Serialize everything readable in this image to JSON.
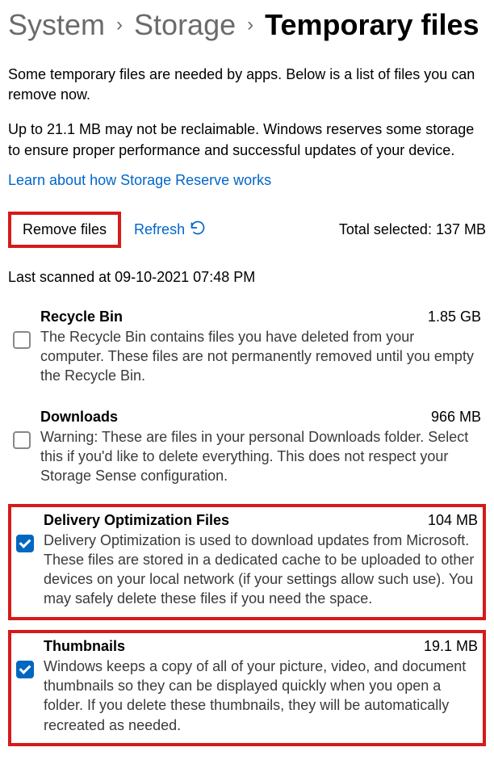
{
  "breadcrumb": {
    "system": "System",
    "storage": "Storage",
    "current": "Temporary files"
  },
  "intro1": "Some temporary files are needed by apps. Below is a list of files you can remove now.",
  "intro2": "Up to 21.1 MB may not be reclaimable. Windows reserves some storage to ensure proper performance and successful updates of your device.",
  "learn_link": "Learn about how Storage Reserve works",
  "actions": {
    "remove": "Remove files",
    "refresh": "Refresh",
    "total_label": "Total selected: ",
    "total_value": "137 MB"
  },
  "scanned": "Last scanned at 09-10-2021 07:48 PM",
  "items": [
    {
      "title": "Recycle Bin",
      "size": "1.85 GB",
      "desc": "The Recycle Bin contains files you have deleted from your computer. These files are not permanently removed until you empty the Recycle Bin.",
      "checked": false,
      "highlight": false
    },
    {
      "title": "Downloads",
      "size": "966 MB",
      "desc": "Warning: These are files in your personal Downloads folder. Select this if you'd like to delete everything. This does not respect your Storage Sense configuration.",
      "checked": false,
      "highlight": false
    },
    {
      "title": "Delivery Optimization Files",
      "size": "104 MB",
      "desc": "Delivery Optimization is used to download updates from Microsoft. These files are stored in a dedicated cache to be uploaded to other devices on your local network (if your settings allow such use). You may safely delete these files if you need the space.",
      "checked": true,
      "highlight": true
    },
    {
      "title": "Thumbnails",
      "size": "19.1 MB",
      "desc": "Windows keeps a copy of all of your picture, video, and document thumbnails so they can be displayed quickly when you open a folder. If you delete these thumbnails, they will be automatically recreated as needed.",
      "checked": true,
      "highlight": true
    }
  ]
}
